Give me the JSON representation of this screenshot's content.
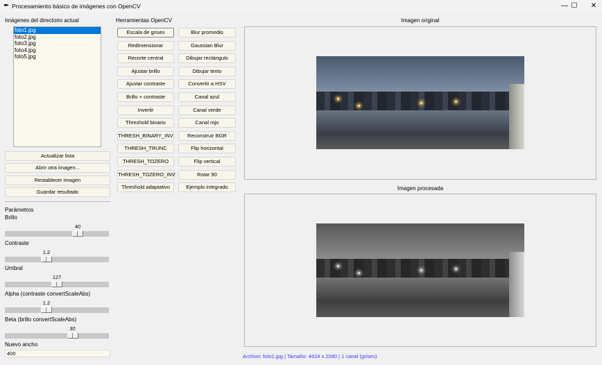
{
  "window": {
    "title": "Procesamiento básico de imágenes con OpenCV",
    "controls": [
      "—",
      "☐",
      "✕"
    ]
  },
  "left": {
    "list_label": "Imágenes del directorio actual",
    "files": [
      "foto1.jpg",
      "foto2.jpg",
      "foto3.jpg",
      "foto4.jpg",
      "foto5.jpg"
    ],
    "selected_index": 0,
    "buttons": [
      "Actualizar lista",
      "Abrir otra imagen...",
      "Restablecer imagen",
      "Guardar resultado"
    ]
  },
  "params": {
    "label": "Parámetros",
    "sliders": [
      {
        "label": "Brillo",
        "value": "40",
        "fraction": 0.7
      },
      {
        "label": "Contraste",
        "value": "1.2",
        "fraction": 0.4
      },
      {
        "label": "Umbral",
        "value": "127",
        "fraction": 0.5
      },
      {
        "label": "Alpha (contraste convertScaleAbs)",
        "value": "1.2",
        "fraction": 0.4
      },
      {
        "label": "Beta (brillo convertScaleAbs)",
        "value": "30",
        "fraction": 0.65
      }
    ],
    "width_label": "Nuevo ancho",
    "width_value": "400"
  },
  "tools": {
    "label": "Herramientas OpenCV",
    "col1": [
      "Escala de grises",
      "Redimensionar",
      "Recorte central",
      "Ajustar brillo",
      "Ajustar contraste",
      "Brillo + contraste",
      "Invertir",
      "Threshold binario",
      "THRESH_BINARY_INV",
      "THRESH_TRUNC",
      "THRESH_TOZERO",
      "THRESH_TOZERO_INV",
      "Threshold adaptativo"
    ],
    "col2": [
      "Blur promedio",
      "Gaussian Blur",
      "Dibujar rectángulo",
      "Dibujar texto",
      "Convertir a HSV",
      "Canal azul",
      "Canal verde",
      "Canal rojo",
      "Reconstruir BGR",
      "Flip horizontal",
      "Flip vertical",
      "Rotar 90",
      "Ejemplo integrado"
    ]
  },
  "images": {
    "original_label": "Imagen original",
    "processed_label": "Imagen procesada"
  },
  "status": {
    "text": "Archivo: foto1.jpg | Tamaño: 4624 x 2080 | 1 canal (grises)",
    "color": "#3a3aff"
  }
}
